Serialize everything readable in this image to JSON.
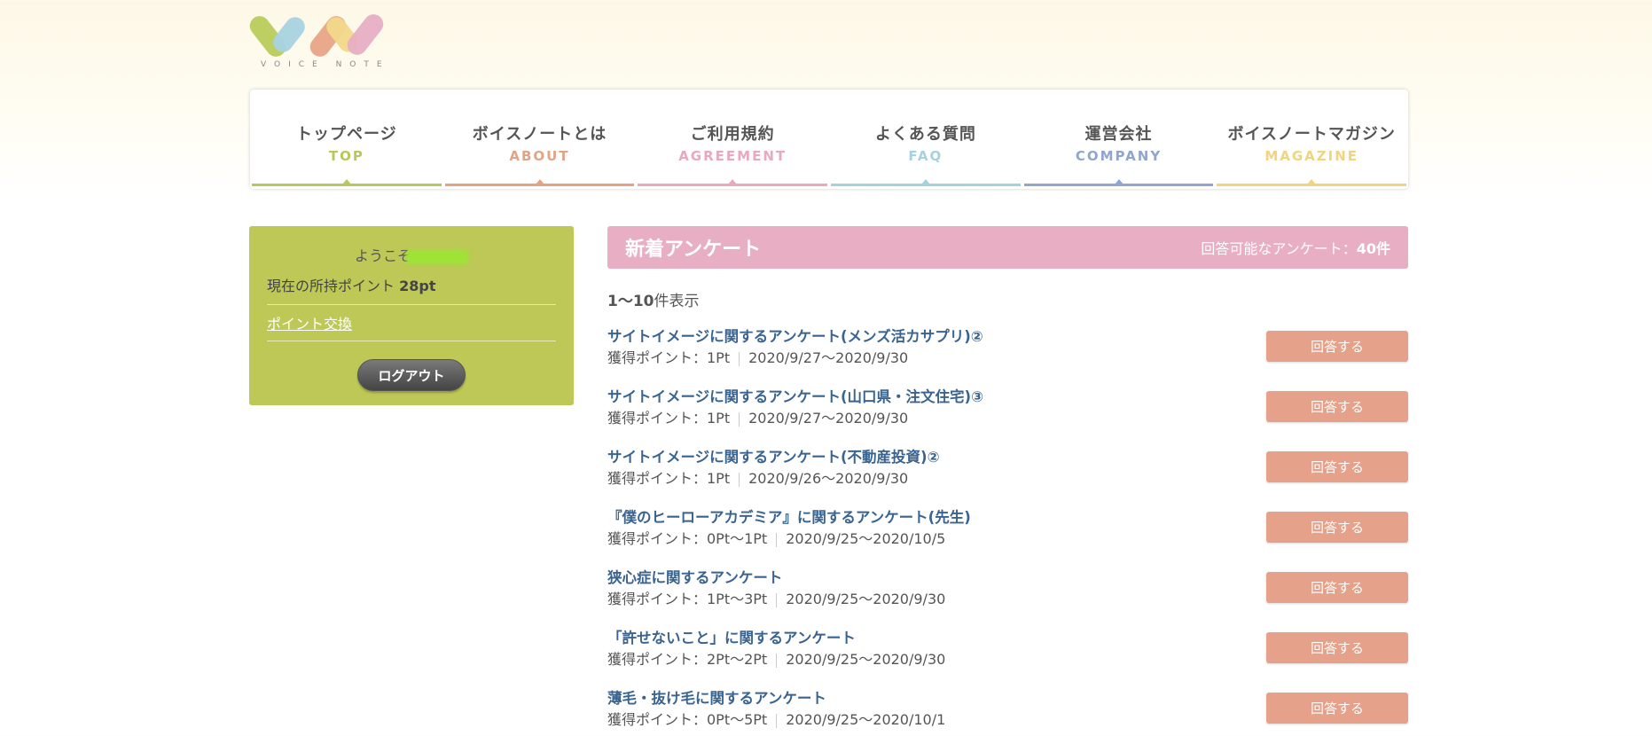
{
  "logo": {
    "text": "VOICE NOTE",
    "colors": [
      "#b9cb5b",
      "#a8d3e0",
      "#e7a488",
      "#f2d88a",
      "#e7afc5"
    ]
  },
  "nav": [
    {
      "id": "top",
      "ja": "トップページ",
      "en": "TOP",
      "color": "#b5c95a"
    },
    {
      "id": "about",
      "ja": "ボイスノートとは",
      "en": "ABOUT",
      "color": "#e3a486"
    },
    {
      "id": "agreement",
      "ja": "ご利用規約",
      "en": "AGREEMENT",
      "color": "#e8a9bf"
    },
    {
      "id": "faq",
      "ja": "よくある質問",
      "en": "FAQ",
      "color": "#a5d2de"
    },
    {
      "id": "company",
      "ja": "運営会社",
      "en": "COMPANY",
      "color": "#8fa6cf"
    },
    {
      "id": "magazine",
      "ja": "ボイスノートマガジン",
      "en": "MAGAZINE",
      "color": "#f0d480"
    }
  ],
  "sidebar": {
    "welcome": "ようこそ",
    "points_label": "現在の所持ポイント",
    "points_value": "28pt",
    "exchange_link": "ポイント交換",
    "logout_button": "ログアウト"
  },
  "main": {
    "title": "新着アンケート",
    "available_label": "回答可能なアンケート：",
    "available_count": "40件",
    "range_bold": "1〜10",
    "range_suffix": "件表示",
    "answer_label": "回答する",
    "surveys": [
      {
        "title": "サイトイメージに関するアンケート(メンズ活カサプリ)②",
        "points": "獲得ポイント：1Pt",
        "period": "2020/9/27〜2020/9/30"
      },
      {
        "title": "サイトイメージに関するアンケート(山口県・注文住宅)③",
        "points": "獲得ポイント：1Pt",
        "period": "2020/9/27〜2020/9/30"
      },
      {
        "title": "サイトイメージに関するアンケート(不動産投資)②",
        "points": "獲得ポイント：1Pt",
        "period": "2020/9/26〜2020/9/30"
      },
      {
        "title": "『僕のヒーローアカデミア』に関するアンケート(先生)",
        "points": "獲得ポイント：0Pt〜1Pt",
        "period": "2020/9/25〜2020/10/5"
      },
      {
        "title": "狭心症に関するアンケート",
        "points": "獲得ポイント：1Pt〜3Pt",
        "period": "2020/9/25〜2020/9/30"
      },
      {
        "title": "「許せないこと」に関するアンケート",
        "points": "獲得ポイント：2Pt〜2Pt",
        "period": "2020/9/25〜2020/9/30"
      },
      {
        "title": "薄毛・抜け毛に関するアンケート",
        "points": "獲得ポイント：0Pt〜5Pt",
        "period": "2020/9/25〜2020/10/1"
      }
    ]
  }
}
